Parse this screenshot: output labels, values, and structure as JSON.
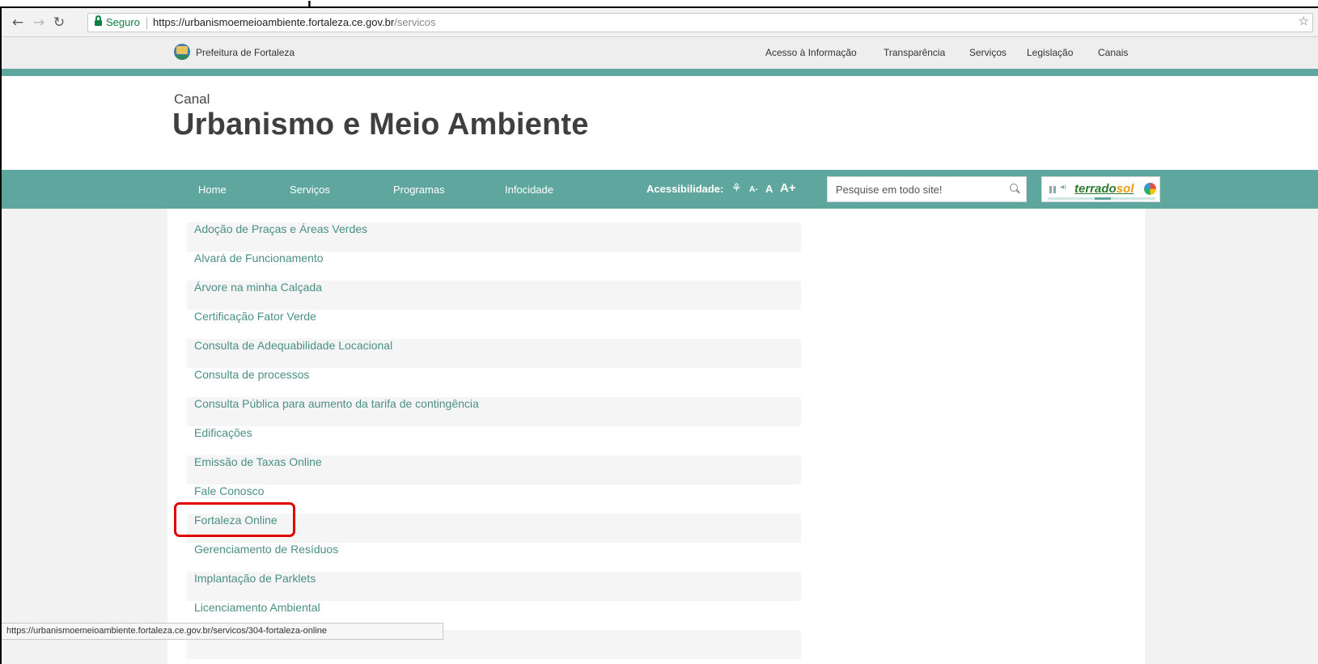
{
  "browser": {
    "secure_label": "Seguro",
    "url_host": "https://urbanismoemeioambiente.fortaleza.ce.gov.br",
    "url_path": "/servicos"
  },
  "topbar": {
    "org_name": "Prefeitura de Fortaleza",
    "links": [
      "Acesso à Informação",
      "Transparência",
      "Serviços",
      "Legislação",
      "Canais"
    ]
  },
  "header": {
    "kicker": "Canal",
    "title": "Urbanismo e Meio Ambiente"
  },
  "mainnav": {
    "items": [
      "Home",
      "Serviços",
      "Programas",
      "Infocidade"
    ],
    "accessibility_label": "Acessibilidade:",
    "font_decrease": "A-",
    "font_normal": "A",
    "font_increase": "A+",
    "search_placeholder": "Pesquise em todo site!",
    "radio_brand_a": "terrado",
    "radio_brand_b": "sol"
  },
  "services": [
    "Adoção de Praças e Áreas Verdes",
    "Alvará de Funcionamento",
    "Árvore na minha Calçada",
    "Certificação Fator Verde",
    "Consulta de Adequabilidade Locacional",
    "Consulta de processos",
    "Consulta Pública para aumento da tarifa de contingência",
    "Edificações",
    "Emissão de Taxas Online",
    "Fale Conosco",
    "Fortaleza Online",
    "Gerenciamento de Resíduos",
    "Implantação de Parklets",
    "Licenciamento Ambiental",
    ""
  ],
  "status_url": "https://urbanismoemeioambiente.fortaleza.ce.gov.br/servicos/304-fortaleza-online",
  "colors": {
    "accent": "#5fa79e",
    "link": "#4b8f85",
    "highlight": "#e00000"
  }
}
